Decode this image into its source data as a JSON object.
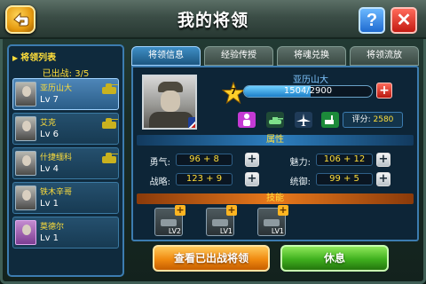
{
  "header": {
    "title": "我的将领",
    "help_label": "?",
    "close_label": "✕"
  },
  "sidebar": {
    "title": "将领列表",
    "deployed": "已出战: 3/5",
    "generals": [
      {
        "name": "亚历山大",
        "level": "Lv 7",
        "deployed": true,
        "selected": true
      },
      {
        "name": "艾克",
        "level": "Lv 6",
        "deployed": true,
        "selected": false
      },
      {
        "name": "什捷缅科",
        "level": "Lv 4",
        "deployed": true,
        "selected": false
      },
      {
        "name": "铁木辛哥",
        "level": "Lv 1",
        "deployed": false,
        "selected": false
      },
      {
        "name": "莫德尔",
        "level": "Lv 1",
        "deployed": false,
        "selected": false
      }
    ]
  },
  "tabs": [
    {
      "label": "将领信息",
      "active": true
    },
    {
      "label": "经验传授",
      "active": false
    },
    {
      "label": "将魂兑换",
      "active": false
    },
    {
      "label": "将领流放",
      "active": false
    }
  ],
  "general": {
    "name": "亚历山大",
    "star_level": "7",
    "exp_text": "1504/2900",
    "exp_fraction": 0.5186,
    "score_label": "评分:",
    "score_value": "2580",
    "type_icons": [
      "infantry-icon",
      "tank-icon",
      "aircraft-icon",
      "artillery-icon"
    ]
  },
  "attributes": {
    "header": "属性",
    "courage_label": "勇气:",
    "courage_value": "96 + 8",
    "charm_label": "魅力:",
    "charm_value": "106 + 12",
    "strategy_label": "战略:",
    "strategy_value": "123 + 9",
    "command_label": "统御:",
    "command_value": "99 + 5"
  },
  "skills": {
    "header": "技能",
    "slots": [
      {
        "level": "LV2"
      },
      {
        "level": "LV1"
      },
      {
        "level": "LV1"
      }
    ]
  },
  "buttons": {
    "view_deployed": "查看已出战将领",
    "rest": "休息"
  },
  "colors": {
    "accent_blue": "#3c7cb0",
    "gold": "#ffde3a",
    "orange": "#f08a10",
    "green": "#3fb01e"
  }
}
